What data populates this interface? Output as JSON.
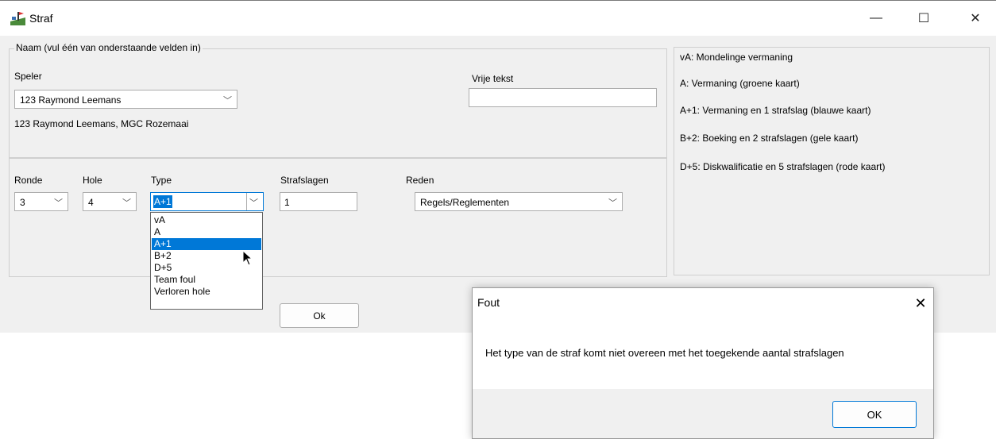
{
  "window": {
    "title": "Straf",
    "minimize_label": "—",
    "maximize_label": "☐",
    "close_label": "✕"
  },
  "name_group": {
    "legend": "Naam (vul één van onderstaande velden in)",
    "speler_label": "Speler",
    "speler_value": "123 Raymond Leemans",
    "speler_info": "123 Raymond Leemans, MGC Rozemaai",
    "vrije_tekst_label": "Vrije tekst",
    "vrije_tekst_value": ""
  },
  "details": {
    "ronde_label": "Ronde",
    "ronde_value": "3",
    "hole_label": "Hole",
    "hole_value": "4",
    "type_label": "Type",
    "type_value": "A+1",
    "type_options": [
      "vA",
      "A",
      "A+1",
      "B+2",
      "D+5",
      "Team foul",
      "Verloren hole"
    ],
    "type_selected_index": 2,
    "strafslagen_label": "Strafslagen",
    "strafslagen_value": "1",
    "reden_label": "Reden",
    "reden_value": "Regels/Reglementen"
  },
  "legend_panel": {
    "lines": [
      "vA: Mondelinge vermaning",
      "A: Vermaning (groene kaart)",
      "A+1: Vermaning en 1 strafslag (blauwe kaart)",
      "B+2: Boeking en 2 strafslagen (gele kaart)",
      "D+5: Diskwalificatie en 5 strafslagen (rode kaart)"
    ]
  },
  "ok_button": "Ok",
  "dialog": {
    "title": "Fout",
    "close_label": "✕",
    "message": "Het type van de straf komt niet overeen met het toegekende aantal strafslagen",
    "ok_label": "OK"
  },
  "icons": [
    "app-icon",
    "chevron-down-icon",
    "mouse-cursor-icon",
    "close-icon"
  ],
  "colors": {
    "selection": "#0078d7",
    "window_bg": "#f0f0f0"
  }
}
